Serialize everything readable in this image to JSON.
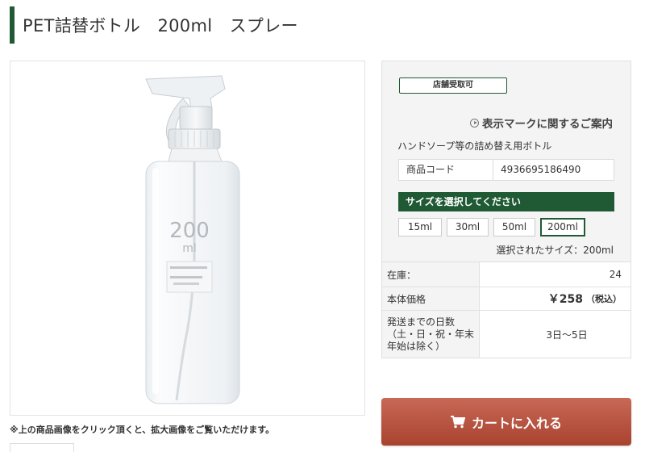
{
  "header": {
    "title": "PET詰替ボトル　200ml　スプレー"
  },
  "image": {
    "bottle_size_text": "200",
    "bottle_unit_text": "ml",
    "note": "※上の商品画像をクリック頂くと、拡大画像をご覧いただけます。"
  },
  "panel": {
    "badge": "店舗受取可",
    "guide_link": "表示マークに関するご案内",
    "description": "ハンドソープ等の詰め替え用ボトル",
    "code_label": "商品コード",
    "code_value": "4936695186490",
    "size_header": "サイズを選択してください",
    "sizes": [
      "15ml",
      "30ml",
      "50ml",
      "200ml"
    ],
    "selected_size_text": "選択されたサイズ：200ml"
  },
  "info": {
    "stock_label": "在庫：",
    "stock_value": "24",
    "price_label": "本体価格",
    "price_value": "￥258",
    "price_tax": "（税込）",
    "ship_label": "発送までの日数（土・日・祝・年末年始は除く）",
    "ship_value": "3日〜5日"
  },
  "cart": {
    "label": "カートに入れる"
  },
  "colors": {
    "accent": "#1f5a34",
    "cart": "#b85440"
  }
}
